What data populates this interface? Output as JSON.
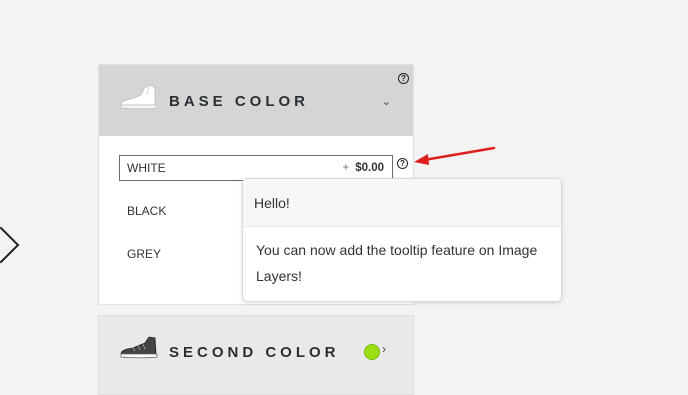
{
  "panels": [
    {
      "title": "BASE COLOR",
      "expanded": true,
      "options": [
        {
          "label": "WHITE",
          "price_prefix": "+",
          "price": "$0.00",
          "selected": true
        },
        {
          "label": "BLACK",
          "selected": false
        },
        {
          "label": "GREY",
          "selected": false
        }
      ]
    },
    {
      "title": "SECOND COLOR",
      "expanded": false,
      "swatch_color": "#9adf14"
    }
  ],
  "help_glyph": "?",
  "tooltip": {
    "title": "Hello!",
    "body": "You can now add the tooltip feature on Image Layers!"
  },
  "annotation_color": "#e0201c"
}
